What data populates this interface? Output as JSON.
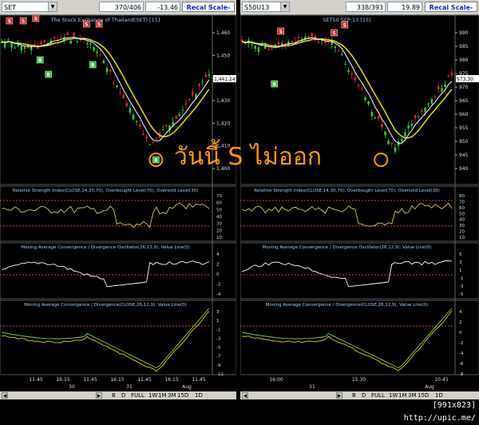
{
  "left": {
    "symbol": "SET",
    "count": "370/406",
    "change": "-13.46",
    "recal_label": "Recal Scale-Linear",
    "main_title": "The Stock Exchange of Thailand(SET) [15]",
    "price_label": "1,441.24",
    "y_ticks": [
      "1,460",
      "1,450",
      "1,440",
      "1,430",
      "1,420",
      "1,410",
      "1,400"
    ],
    "rsi_title": "Relative Strength Index(CLOSE,14,30,70), Overbought Level(70), Oversold Level(30)",
    "rsi_ticks": [
      "70",
      "60",
      "50",
      "40",
      "30",
      "20",
      "10"
    ],
    "macd_title": "Moving Average Convergence / Divergence Oscillator(26,12,9), Value Line(0)",
    "macd_ticks": [
      "4",
      "2",
      "0",
      "-2",
      "-4"
    ],
    "macd2_title": "Moving Average Convergence / Divergence(CLOSE,26,12,9), Value Line(0)",
    "macd2_ticks": [
      "3",
      "1",
      "-1",
      "-3",
      "-5",
      "-7",
      "-9",
      "-11"
    ],
    "time_ticks": [
      "11:45",
      "16:15",
      "11:45",
      "16:15",
      "11:45",
      "16:15",
      "11:45"
    ],
    "date_ticks": [
      "30",
      "31",
      "Aug"
    ],
    "signals": [
      {
        "t": "S",
        "x": 0.045,
        "y": 7
      },
      {
        "t": "S",
        "x": 0.11,
        "y": 7
      },
      {
        "t": "S",
        "x": 0.17,
        "y": 4
      },
      {
        "t": "S",
        "x": 0.41,
        "y": 11
      },
      {
        "t": "S",
        "x": 0.47,
        "y": 11
      },
      {
        "t": "B",
        "x": 0.19,
        "y": 56
      },
      {
        "t": "B",
        "x": 0.23,
        "y": 74
      },
      {
        "t": "B",
        "x": 0.44,
        "y": 62
      },
      {
        "t": "B",
        "x": 0.74,
        "y": 181
      }
    ]
  },
  "right": {
    "symbol": "S50U13",
    "count": "338/393",
    "change": "19.89",
    "recal_label": "Recal Scale-Linear",
    "main_title": "SET50 SEP 13 [15]",
    "price_label": "973.30",
    "y_ticks": [
      "990",
      "985",
      "980",
      "975",
      "970",
      "965",
      "960",
      "955",
      "950",
      "945",
      "940"
    ],
    "rsi_title": "Relative Strength Index(CLOSE,14,30,70), Overbought Level(70), Oversold Level(30)",
    "rsi_ticks": [
      "80",
      "70",
      "60",
      "50",
      "40",
      "30",
      "20",
      "10"
    ],
    "macd_title": "Moving Average Convergence / Divergence Oscillator(26,12,9), Value Line(0)",
    "macd_ticks": [
      "5",
      "3",
      "1",
      "-1",
      "-3",
      "-5"
    ],
    "macd2_title": "Moving Average Convergence / Divergence(CLOSE,26,12,9), Value Line(0)",
    "macd2_ticks": [
      "4",
      "2",
      "0",
      "-2",
      "-4",
      "-6",
      "-8"
    ],
    "time_ticks": [
      "16:00",
      "15:30",
      "10:45"
    ],
    "date_ticks": [
      "31",
      "Aug"
    ],
    "signals": [
      {
        "t": "S",
        "x": 0.19,
        "y": 20
      },
      {
        "t": "S",
        "x": 0.44,
        "y": 22
      },
      {
        "t": "S",
        "x": 0.49,
        "y": 12
      },
      {
        "t": "B",
        "x": 0.16,
        "y": 86
      }
    ]
  },
  "overlay_text": "วันนี้ S ไม่ออก",
  "bottom_buttons": [
    "B",
    "D",
    "FULL",
    "1W",
    "1M",
    "3M",
    "15D",
    "1D"
  ],
  "watermark": "[991x823] http://upic.me/"
}
